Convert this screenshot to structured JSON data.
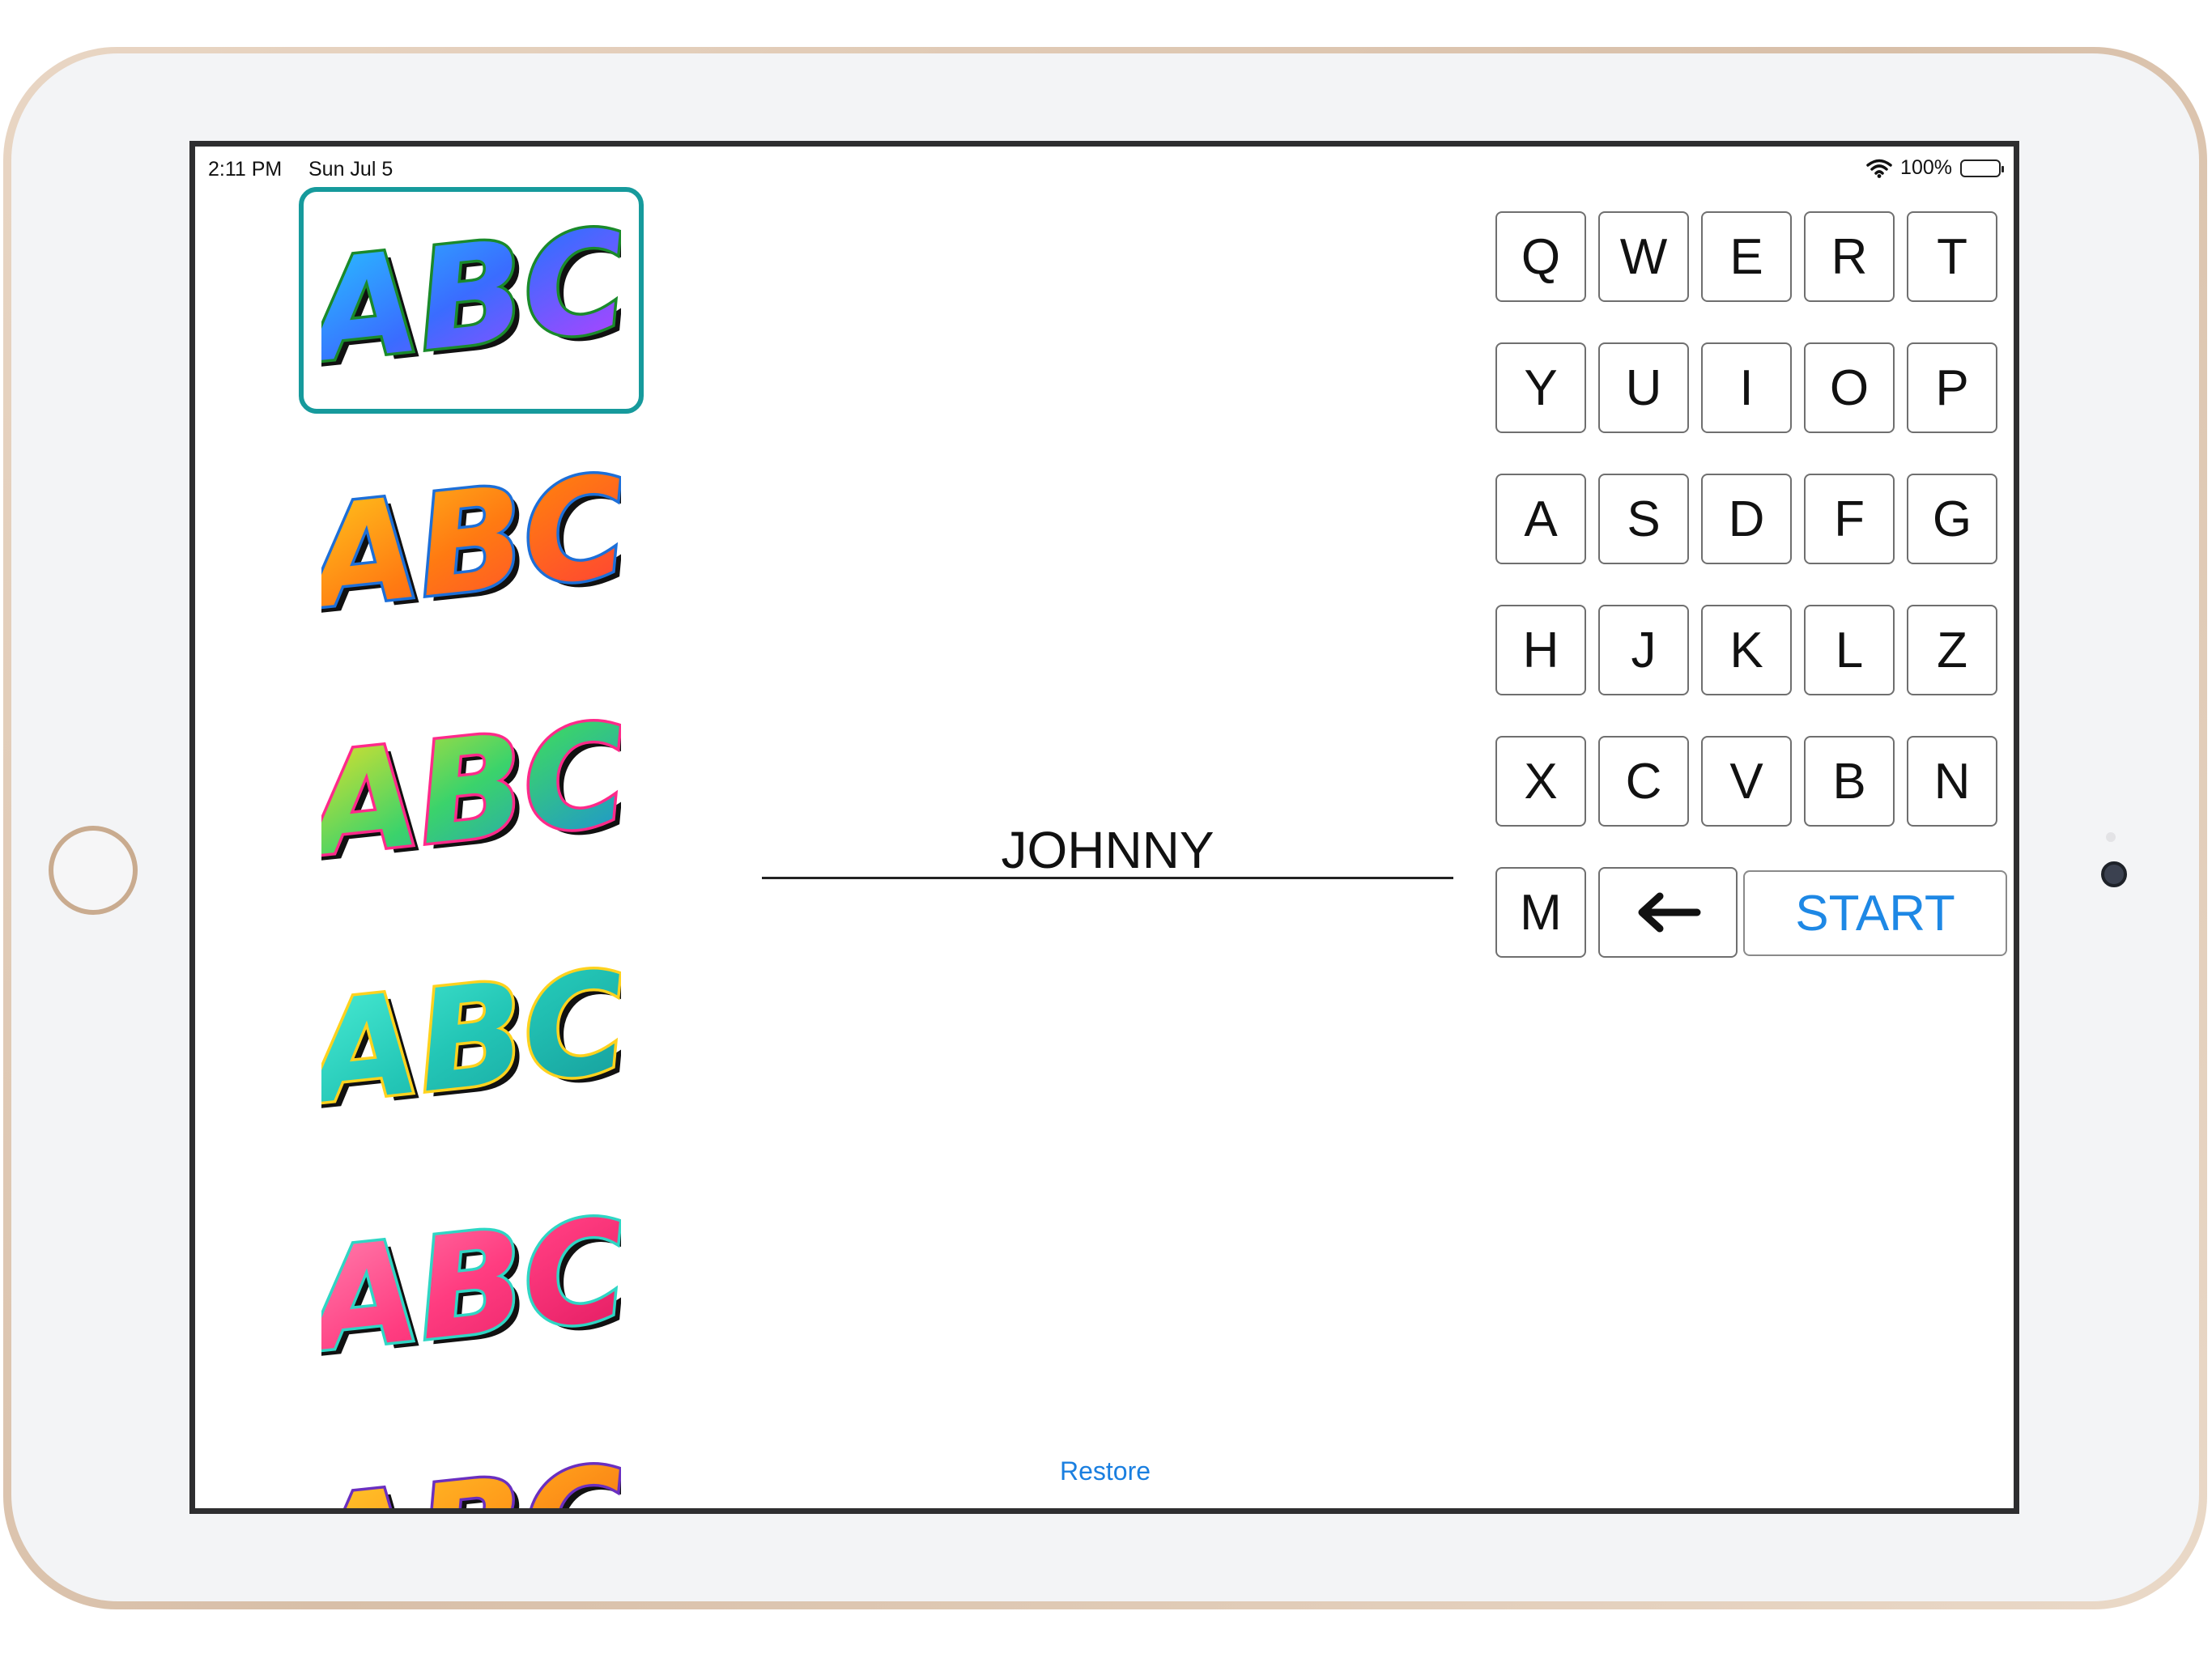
{
  "status_bar": {
    "time": "2:11 PM",
    "date": "Sun Jul 5",
    "battery": "100%"
  },
  "styles": [
    {
      "label": "ABC",
      "fill": [
        "#25d0ff",
        "#3a6cff",
        "#c43bff"
      ],
      "outline": "#1a8a2a",
      "selected": true
    },
    {
      "label": "ABC",
      "fill": [
        "#ffd21e",
        "#ff7a12",
        "#ff3a3a"
      ],
      "outline": "#1d6fd8",
      "selected": false
    },
    {
      "label": "ABC",
      "fill": [
        "#ffe31e",
        "#3bd36b",
        "#1a8be0"
      ],
      "outline": "#ff2a8a",
      "selected": false
    },
    {
      "label": "ABC",
      "fill": [
        "#4ff2d8",
        "#23c6b6",
        "#159a9a"
      ],
      "outline": "#ffd21e",
      "selected": false
    },
    {
      "label": "ABC",
      "fill": [
        "#ff8ab5",
        "#ff3c80",
        "#e0185f"
      ],
      "outline": "#2fd6c4",
      "selected": false
    },
    {
      "label": "ABC",
      "fill": [
        "#ffcf2e",
        "#ff9a1a",
        "#f06010"
      ],
      "outline": "#6a2fc0",
      "selected": false
    }
  ],
  "name_field": {
    "value": "JOHNNY"
  },
  "keyboard": {
    "rows": [
      [
        "Q",
        "W",
        "E",
        "R",
        "T"
      ],
      [
        "Y",
        "U",
        "I",
        "O",
        "P"
      ],
      [
        "A",
        "S",
        "D",
        "F",
        "G"
      ],
      [
        "H",
        "J",
        "K",
        "L",
        "Z"
      ],
      [
        "X",
        "C",
        "V",
        "B",
        "N"
      ]
    ],
    "last_row_key": "M",
    "backspace_icon": "left-arrow-icon",
    "start_label": "START"
  },
  "restore_label": "Restore",
  "colors": {
    "accent_blue": "#1e88e5",
    "selection_teal": "#169a9c"
  }
}
